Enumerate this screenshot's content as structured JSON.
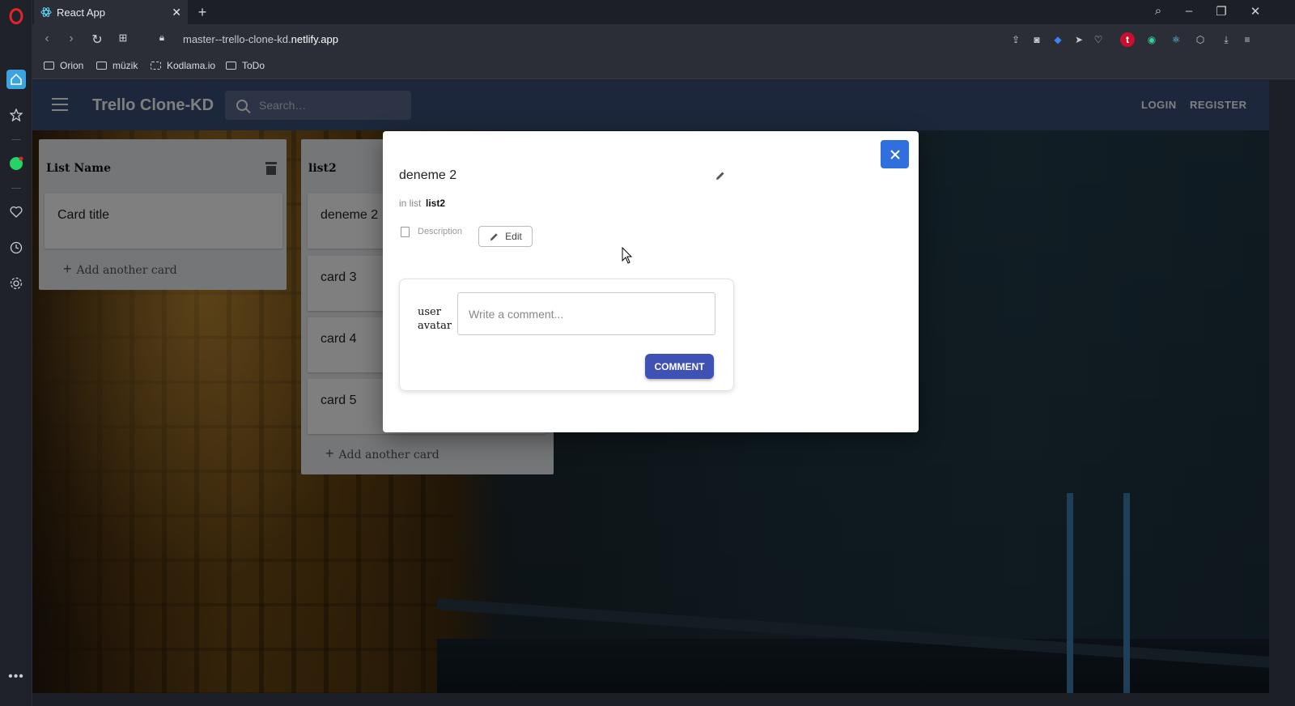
{
  "browser": {
    "tab_title": "React App",
    "url_prefix": "master--trello-clone-kd.",
    "url_domain": "netlify.app",
    "bookmarks": [
      {
        "label": "Orion"
      },
      {
        "label": "müzik"
      },
      {
        "label": "Kodlama.io"
      },
      {
        "label": "ToDo"
      }
    ]
  },
  "header": {
    "title": "Trello Clone-KD",
    "search_placeholder": "Search…",
    "login": "LOGIN",
    "register": "REGISTER"
  },
  "lists": [
    {
      "title": "List Name",
      "cards": [
        "Card title"
      ],
      "add_label": "Add another card"
    },
    {
      "title": "list2",
      "cards": [
        "deneme 2",
        "card 3",
        "card 4",
        "card 5"
      ],
      "add_label": "Add another card"
    }
  ],
  "modal": {
    "card_title": "deneme 2",
    "in_list_label": "in list",
    "list_name": "list2",
    "description_label": "Description",
    "edit_label": "Edit",
    "avatar_text": "user avatar",
    "comment_placeholder": "Write a comment...",
    "comment_button": "COMMENT"
  },
  "colors": {
    "header_bg": "#3b4e78",
    "close_button": "#2f6fde",
    "comment_button": "#3f51b5"
  }
}
